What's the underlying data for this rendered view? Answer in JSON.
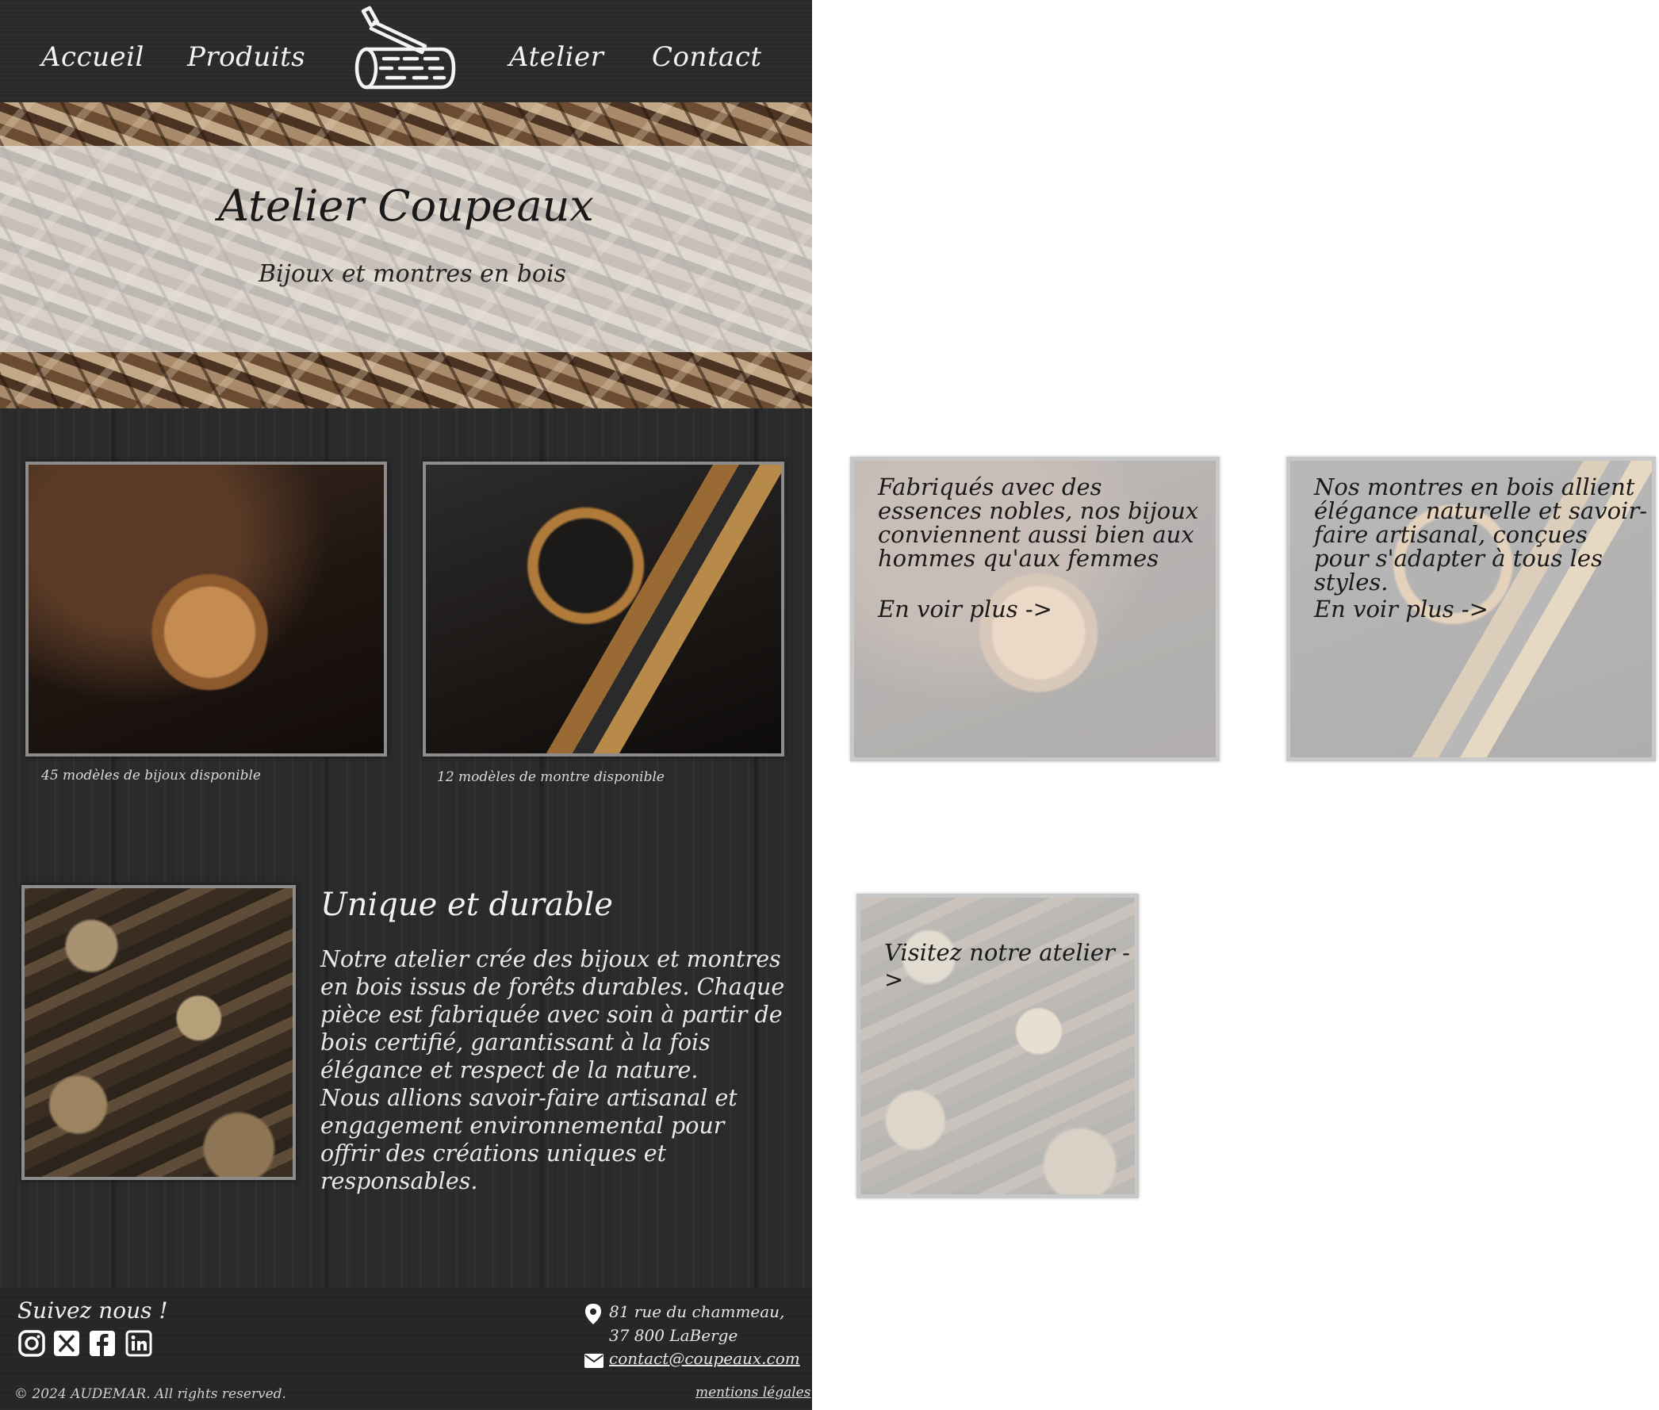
{
  "nav": {
    "home": "Accueil",
    "products": "Produits",
    "workshop": "Atelier",
    "contact": "Contact"
  },
  "logo": {
    "icon": "log-with-saw-icon"
  },
  "hero": {
    "title": "Atelier Coupeaux",
    "subtitle": "Bijoux et montres en bois"
  },
  "products": [
    {
      "image": "wooden-pendant-photo",
      "caption": "45 modèles de bijoux disponible"
    },
    {
      "image": "wooden-watch-photo",
      "caption": "12 modèles de montre disponible"
    }
  ],
  "about": {
    "image": "stacked-logs-photo",
    "title": "Unique et durable",
    "paragraph1": "Notre atelier crée des bijoux et montres en bois issus de forêts durables. Chaque pièce est fabriquée avec soin à partir de bois certifié, garantissant à la fois élégance et respect de la nature.",
    "paragraph2": "Nous allions savoir-faire artisanal et engagement environnemental pour offrir des créations uniques et responsables."
  },
  "hover_cards": [
    {
      "text": "Fabriqués avec des essences nobles, nos bijoux conviennent aussi bien aux hommes qu'aux femmes",
      "link": "En voir plus ->"
    },
    {
      "text": "Nos montres en bois allient élégance naturelle et savoir-faire artisanal, conçues pour s'adapter à tous les styles.",
      "link": "En voir plus ->"
    },
    {
      "text": "",
      "link": "Visitez notre atelier ->"
    }
  ],
  "footer": {
    "follow": "Suivez nous !",
    "social": [
      "instagram-icon",
      "x-icon",
      "facebook-icon",
      "linkedin-icon"
    ],
    "address_line1": "81 rue du chammeau,",
    "address_line2": "37 800 LaBerge",
    "email": "contact@coupeaux.com",
    "copyright": "© 2024 AUDEMAR. All rights reserved.",
    "legal": "mentions légales"
  }
}
